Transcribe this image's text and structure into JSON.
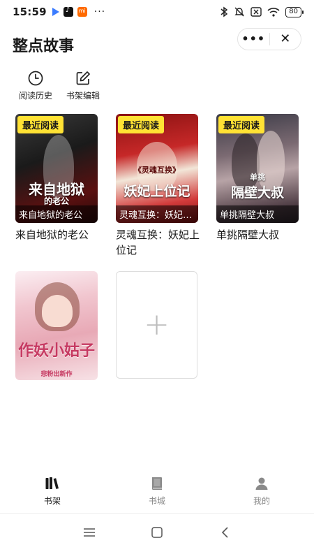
{
  "status_bar": {
    "time": "15:59",
    "dots": "···",
    "battery": "80",
    "icons": [
      "play-icon",
      "tiktok-icon",
      "mi-icon",
      "bluetooth-icon",
      "mute-icon",
      "no-sim-icon",
      "wifi-icon",
      "battery-icon"
    ]
  },
  "header": {
    "title": "整点故事",
    "more_icon": "more-dots-icon",
    "close_icon": "close-icon"
  },
  "tools": [
    {
      "label": "阅读历史",
      "icon": "clock-icon"
    },
    {
      "label": "书架编辑",
      "icon": "edit-icon"
    }
  ],
  "books": [
    {
      "badge": "最近阅读",
      "cover_caption": "来自地狱的老公",
      "cover_art": "来自地狱",
      "cover_sub": "的老公",
      "title": "来自地狱的老公"
    },
    {
      "badge": "最近阅读",
      "cover_caption": "灵魂互换：妖妃…",
      "cover_art": "妖妃上位记",
      "cover_sub": "《灵魂互换》",
      "title": "灵魂互换：妖妃上位记"
    },
    {
      "badge": "最近阅读",
      "cover_caption": "单挑隔壁大叔",
      "cover_art": "隔壁大叔",
      "cover_sub": "单挑",
      "title": "单挑隔壁大叔"
    },
    {
      "cover_art": "作妖小姑子",
      "cover_sub": "悲粉出新作",
      "title": ""
    }
  ],
  "add_tile": {
    "label": "+"
  },
  "bottom_nav": [
    {
      "label": "书架",
      "icon": "bookshelf-icon",
      "active": true
    },
    {
      "label": "书城",
      "icon": "book-icon",
      "active": false
    },
    {
      "label": "我的",
      "icon": "person-icon",
      "active": false
    }
  ],
  "colors": {
    "badge": "#ffe234",
    "active_nav": "#1a1a1a",
    "inactive_nav": "#888888"
  }
}
